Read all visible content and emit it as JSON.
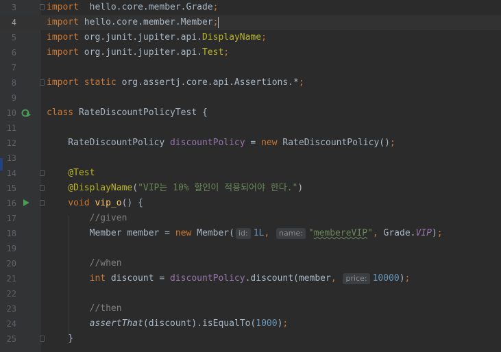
{
  "editor": {
    "lines": [
      {
        "num": "3",
        "parts": [
          [
            "kw",
            "import"
          ],
          [
            "",
            "  hello.core.member.Grade"
          ],
          [
            "kw",
            ";"
          ]
        ]
      },
      {
        "num": "4",
        "parts": [
          [
            "kw",
            "import"
          ],
          [
            "",
            " hello.core.member.Member"
          ],
          [
            "kw",
            ";"
          ]
        ]
      },
      {
        "num": "5",
        "parts": [
          [
            "kw",
            "import"
          ],
          [
            "",
            " org.junit.jupiter.api."
          ],
          [
            "ann",
            "DisplayName"
          ],
          [
            "kw",
            ";"
          ]
        ]
      },
      {
        "num": "6",
        "parts": [
          [
            "kw",
            "import"
          ],
          [
            "",
            " org.junit.jupiter.api."
          ],
          [
            "ann",
            "Test"
          ],
          [
            "kw",
            ";"
          ]
        ]
      },
      {
        "num": "7",
        "parts": []
      },
      {
        "num": "8",
        "parts": [
          [
            "kw",
            "import static"
          ],
          [
            "",
            " org.assertj.core.api.Assertions.*"
          ],
          [
            "kw",
            ";"
          ]
        ]
      },
      {
        "num": "9",
        "parts": []
      },
      {
        "num": "10",
        "parts": [
          [
            "kw",
            "class"
          ],
          [
            "",
            " RateDiscountPolicyTest {"
          ]
        ]
      },
      {
        "num": "11",
        "parts": []
      },
      {
        "num": "12",
        "parts": [
          [
            "",
            "    RateDiscountPolicy "
          ],
          [
            "fld",
            "discountPolicy"
          ],
          [
            "",
            " = "
          ],
          [
            "kw",
            "new"
          ],
          [
            "",
            " RateDiscountPolicy()"
          ],
          [
            "kw",
            ";"
          ]
        ]
      },
      {
        "num": "13",
        "parts": []
      },
      {
        "num": "14",
        "parts": [
          [
            "ann",
            "    @Test"
          ]
        ]
      },
      {
        "num": "15",
        "parts": [
          [
            "ann",
            "    @DisplayName"
          ],
          [
            "",
            "("
          ],
          [
            "str",
            "\"VIP는 10% 할인이 적용되어야 한다.\""
          ],
          [
            "",
            ")"
          ]
        ]
      },
      {
        "num": "16",
        "parts": [
          [
            "kw",
            "    void"
          ],
          [
            "fn",
            " vip_o"
          ],
          [
            "",
            "() {"
          ]
        ]
      },
      {
        "num": "17",
        "parts": [
          [
            "cmt",
            "        //given"
          ]
        ]
      },
      {
        "num": "18",
        "parts": [
          [
            "",
            "        Member member = "
          ],
          [
            "kw",
            "new"
          ],
          [
            "",
            " Member("
          ],
          [
            "hint",
            "id:"
          ],
          [
            "num",
            "1L"
          ],
          [
            "kw",
            ", "
          ],
          [
            "hint",
            "name:"
          ],
          [
            "str",
            "\"membereVIP\""
          ],
          [
            "kw",
            ","
          ],
          [
            "",
            " Grade."
          ],
          [
            "stat",
            "VIP"
          ],
          [
            "",
            ")"
          ],
          [
            "kw",
            ";"
          ]
        ]
      },
      {
        "num": "19",
        "parts": []
      },
      {
        "num": "20",
        "parts": [
          [
            "cmt",
            "        //when"
          ]
        ]
      },
      {
        "num": "21",
        "parts": [
          [
            "kw",
            "        int"
          ],
          [
            "",
            " discount = "
          ],
          [
            "fld",
            "discountPolicy"
          ],
          [
            "",
            ".discount(member"
          ],
          [
            "kw",
            ", "
          ],
          [
            "hint",
            "price:"
          ],
          [
            "num",
            "10000"
          ],
          [
            "",
            ")"
          ],
          [
            "kw",
            ";"
          ]
        ]
      },
      {
        "num": "22",
        "parts": []
      },
      {
        "num": "23",
        "parts": [
          [
            "cmt",
            "        //then"
          ]
        ]
      },
      {
        "num": "24",
        "parts": [
          [
            "ital",
            "        assertThat"
          ],
          [
            "",
            "(discount).isEqualTo("
          ],
          [
            "num",
            "1000"
          ],
          [
            "",
            ")"
          ],
          [
            "kw",
            ";"
          ]
        ]
      },
      {
        "num": "25",
        "parts": [
          [
            "",
            "    }"
          ]
        ]
      }
    ],
    "current_line": "4"
  }
}
